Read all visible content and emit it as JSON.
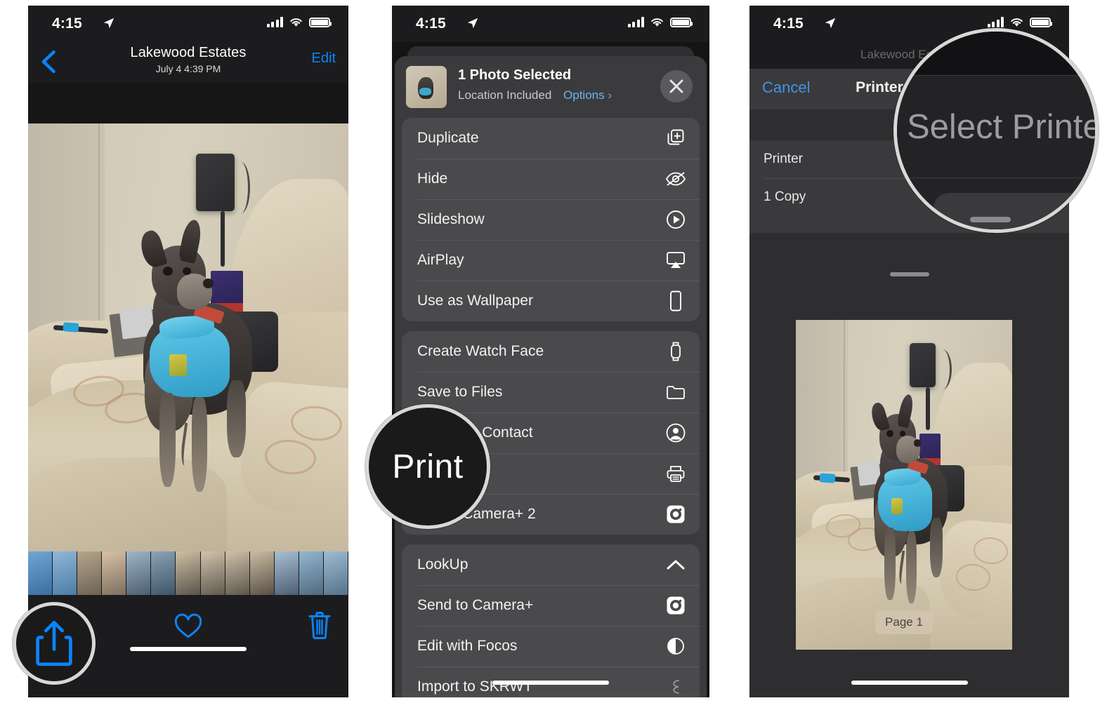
{
  "statusbar": {
    "time": "4:15",
    "location_icon": "location-arrow-icon",
    "cellular_icon": "cellular-bars-icon",
    "wifi_icon": "wifi-icon",
    "battery_icon": "battery-full-icon"
  },
  "panel1": {
    "nav": {
      "back_icon": "chevron-left-icon",
      "title": "Lakewood Estates",
      "subtitle": "July 4  4:39 PM",
      "edit_label": "Edit"
    },
    "toolbar": {
      "share_icon": "share-icon",
      "favorite_icon": "heart-icon",
      "delete_icon": "trash-icon"
    },
    "callout": {
      "label": "",
      "icon": "share-icon"
    }
  },
  "panel2": {
    "header": {
      "title": "1 Photo Selected",
      "subtitle": "Location Included",
      "options_label": "Options ›",
      "close_icon": "close-icon",
      "thumbnail": "photo-thumbnail"
    },
    "groups": [
      {
        "items": [
          {
            "label": "Duplicate",
            "icon": "duplicate-icon"
          },
          {
            "label": "Hide",
            "icon": "eye-slash-icon"
          },
          {
            "label": "Slideshow",
            "icon": "play-circle-icon"
          },
          {
            "label": "AirPlay",
            "icon": "airplay-icon"
          },
          {
            "label": "Use as Wallpaper",
            "icon": "phone-icon"
          }
        ]
      },
      {
        "items": [
          {
            "label": "Create Watch Face",
            "icon": "watch-icon"
          },
          {
            "label": "Save to Files",
            "icon": "folder-icon"
          },
          {
            "label": "Assign to Contact",
            "icon": "contact-circle-icon"
          },
          {
            "label": "Print",
            "icon": "printer-icon"
          },
          {
            "label": "Edit in Camera+ 2",
            "icon": "camera-plus-2-icon"
          }
        ]
      },
      {
        "items": [
          {
            "label": "LookUp",
            "icon": "chevron-up-icon"
          },
          {
            "label": "Send to Camera+",
            "icon": "camera-plus-icon"
          },
          {
            "label": "Edit with Focos",
            "icon": "focos-icon"
          },
          {
            "label": "Import to SKRWT",
            "icon": "skrwt-icon"
          }
        ]
      }
    ],
    "callout": {
      "label": "Print"
    }
  },
  "panel3": {
    "ghost_title": "Lakewood Estates",
    "nav": {
      "cancel_label": "Cancel",
      "title": "Printer Options"
    },
    "rows": [
      {
        "label": "Printer",
        "value": ""
      },
      {
        "label": "1 Copy",
        "value": ""
      }
    ],
    "preview": {
      "page_label": "Page 1"
    },
    "callout": {
      "label": "Select Printer"
    }
  },
  "colors": {
    "accent_blue": "#0a84ff",
    "link_blue": "#6bb4f5",
    "sheet_bg": "#3b3b3d",
    "row_bg": "#4a4a4c",
    "screen_bg": "#1c1c1e",
    "callout_ring": "#d8d8d8"
  }
}
